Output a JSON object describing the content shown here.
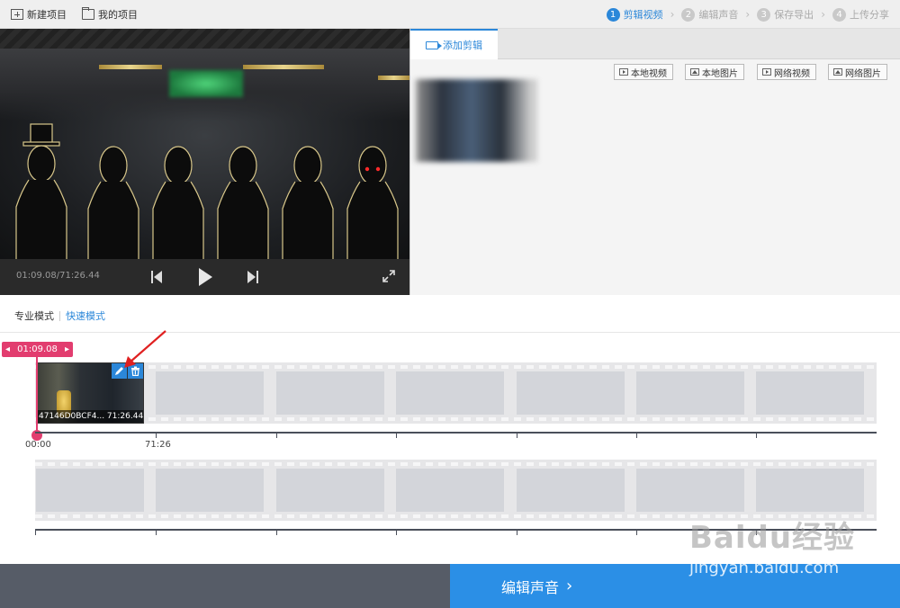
{
  "toolbar": {
    "new_project": "新建项目",
    "my_projects": "我的项目"
  },
  "steps": [
    {
      "num": "1",
      "label": "剪辑视频",
      "active": true
    },
    {
      "num": "2",
      "label": "编辑声音",
      "active": false
    },
    {
      "num": "3",
      "label": "保存导出",
      "active": false
    },
    {
      "num": "4",
      "label": "上传分享",
      "active": false
    }
  ],
  "player": {
    "time": "01:09.08/71:26.44"
  },
  "right_panel": {
    "tab_label": "添加剪辑",
    "source_buttons": [
      "本地视频",
      "本地图片",
      "网络视频",
      "网络图片"
    ]
  },
  "modes": {
    "pro": "专业模式",
    "quick": "快速模式"
  },
  "timeline": {
    "playhead_time": "01:09.08",
    "clip_label": "47146D0BCF4... 71:26.44",
    "ruler_start": "00:00",
    "ruler_mark": "71:26"
  },
  "bottom": {
    "next_label": "编辑声音"
  },
  "watermark": {
    "brand": "Baidu经验",
    "url": "jingyan.baidu.com"
  },
  "colors": {
    "accent": "#2b87d9",
    "playhead": "#e23d6f",
    "bottom_left": "#565c67",
    "bottom_right": "#2b8fe6"
  }
}
